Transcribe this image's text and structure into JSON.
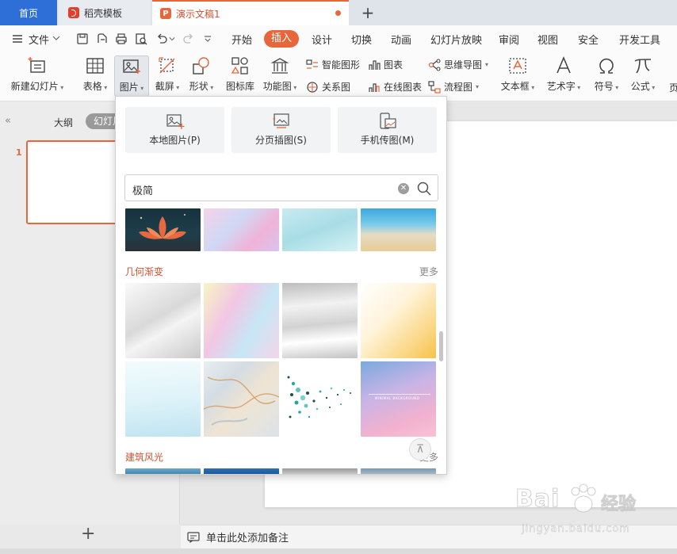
{
  "tabs": {
    "home": "首页",
    "template": "稻壳模板",
    "document": "演示文稿1",
    "add": "+"
  },
  "menu": {
    "file": "文件",
    "items": [
      "开始",
      "插入",
      "设计",
      "切换",
      "动画",
      "幻灯片放映",
      "审阅",
      "视图",
      "安全",
      "开发工具"
    ],
    "active": "插入"
  },
  "ribbon": {
    "new_slide": "新建幻灯片",
    "table": "表格",
    "picture": "图片",
    "screenshot": "截屏",
    "shape": "形状",
    "icon_lib": "图标库",
    "func_chart": "功能图",
    "smart_shape": "智能图形",
    "chart": "图表",
    "relation": "关系图",
    "online_chart": "在线图表",
    "mindmap": "思维导图",
    "flowchart": "流程图",
    "textbox": "文本框",
    "wordart": "艺术字",
    "symbol": "符号",
    "formula": "公式",
    "more": "页"
  },
  "leftpanel": {
    "outline": "大纲",
    "slides": "幻灯片",
    "slide_number": "1",
    "add": "+"
  },
  "notes": {
    "placeholder": "单击此处添加备注"
  },
  "picture_panel": {
    "local_picture": "本地图片(P)",
    "page_picture": "分页插图(S)",
    "phone_picture": "手机传图(M)",
    "search_value": "极简",
    "sections": [
      {
        "title": "几何渐变",
        "more": "更多"
      },
      {
        "title": "建筑风光",
        "more": "更多"
      }
    ],
    "thumb_text": "MINIMAL BACKGROUND"
  },
  "watermark": {
    "brand": "Bai",
    "brand_cn": "经验",
    "url": "jingyan.baidu.com"
  },
  "colors": {
    "accent": "#e9663b",
    "home_tab": "#2d6fd6",
    "section_title": "#d2512f"
  }
}
